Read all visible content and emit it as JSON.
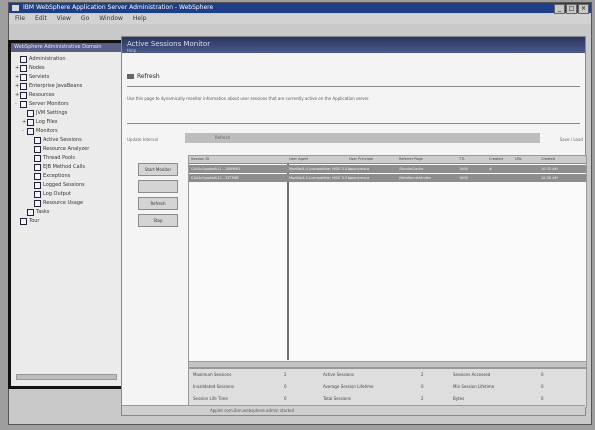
{
  "window": {
    "title": "IBM WebSphere Application Server Administration - WebSphere"
  },
  "menu": [
    "File",
    "Edit",
    "View",
    "Go",
    "Window",
    "Help"
  ],
  "nav": {
    "header": "WebSphere Administrative Domain",
    "items": [
      {
        "label": "Administration",
        "level": 0,
        "toggle": ""
      },
      {
        "label": "Nodes",
        "level": 0,
        "toggle": "+"
      },
      {
        "label": "Servlets",
        "level": 0,
        "toggle": "+"
      },
      {
        "label": "Enterprise JavaBeans",
        "level": 0,
        "toggle": "+"
      },
      {
        "label": "Resources",
        "level": 0,
        "toggle": "+"
      },
      {
        "label": "Server Monitors",
        "level": 0,
        "toggle": "-"
      },
      {
        "label": "JVM Settings",
        "level": 1,
        "toggle": ""
      },
      {
        "label": "Log Files",
        "level": 1,
        "toggle": "+"
      },
      {
        "label": "Monitors",
        "level": 1,
        "toggle": "-"
      },
      {
        "label": "Active Sessions",
        "level": 2,
        "toggle": ""
      },
      {
        "label": "Resource Analyzer",
        "level": 2,
        "toggle": ""
      },
      {
        "label": "Thread Pools",
        "level": 2,
        "toggle": ""
      },
      {
        "label": "EJB Method Calls",
        "level": 2,
        "toggle": ""
      },
      {
        "label": "Exceptions",
        "level": 2,
        "toggle": ""
      },
      {
        "label": "Logged Sessions",
        "level": 2,
        "toggle": ""
      },
      {
        "label": "Log Output",
        "level": 2,
        "toggle": ""
      },
      {
        "label": "Resource Usage",
        "level": 2,
        "toggle": ""
      },
      {
        "label": "Tasks",
        "level": 1,
        "toggle": ""
      },
      {
        "label": "Tour",
        "level": 0,
        "toggle": ""
      }
    ]
  },
  "content": {
    "title": "Active Sessions Monitor",
    "subtitle": "Help",
    "refresh_label": "Refresh",
    "description": "Use this page to dynamically monitor information about user sessions that are currently active on the Application server.",
    "options_label": "Update Interval",
    "options_bar": "Refresh",
    "options_right": "Save / Load",
    "buttons": [
      "Start Monitor",
      "",
      "Refresh",
      "Stop"
    ],
    "table": {
      "columns": [
        "Session ID",
        "User Agent",
        "User Principal",
        "Referrer Page",
        "TTL",
        "Created",
        "URL",
        "Created"
      ],
      "rows": [
        [
          "CA04c0gqdwfk11...1BR9MD",
          "Mozilla/4.0 (compatible; MSIE 5.01;...",
          "anonymous",
          "/ServletCache",
          "1800",
          "#",
          "",
          "10:35 AM"
        ],
        [
          "CA04c0gqdwfk12...3ZTM8F",
          "Mozilla/4.0 (compatible; MSIE 5.01;...",
          "anonymous",
          "/WebServlet/index",
          "1800",
          "",
          "",
          "10:36 AM"
        ]
      ]
    },
    "stats": [
      [
        "Maximum Sessions",
        "2",
        "Active Sessions",
        "2",
        "Sessions Accessed",
        "0"
      ],
      [
        "Invalidated Sessions",
        "0",
        "Average Session Lifetime",
        "0",
        "Min Session Lifetime",
        "0"
      ],
      [
        "Session Life Time",
        "0",
        "Total Sessions",
        "2",
        "Bytes",
        "0"
      ]
    ]
  },
  "status": {
    "text": "Applet com.ibm.websphere.admin started"
  }
}
